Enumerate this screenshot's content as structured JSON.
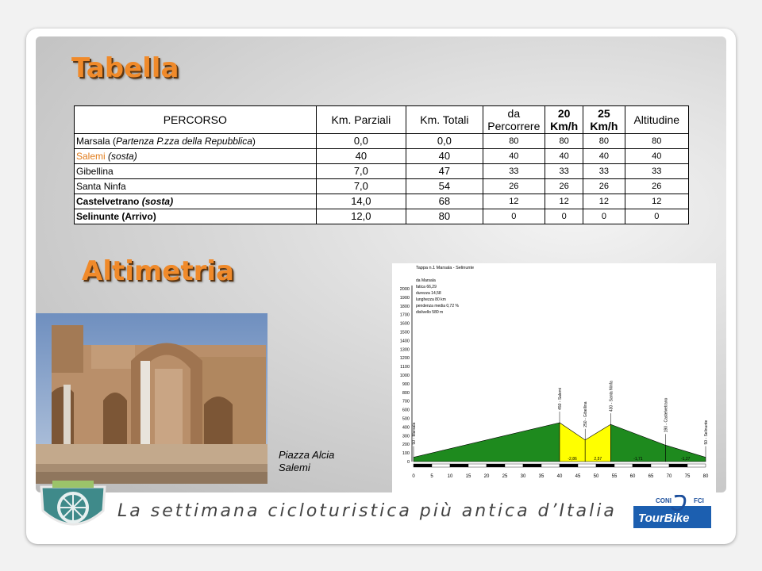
{
  "slide": {
    "title_table": "Tabella",
    "title_altimetry": "Altimetria",
    "tagline": "La settimana cicloturistica più antica d’Italia"
  },
  "table": {
    "headers": {
      "percorso": "PERCORSO",
      "km_parziali": "Km. Parziali",
      "km_totali": "Km. Totali",
      "da": "da",
      "percorrere": "Percorrere",
      "v20a": "20",
      "v20b": "Km/h",
      "v25a": "25",
      "v25b": "Km/h",
      "altitudine": "Altitudine"
    },
    "rows": [
      {
        "name_a": "Marsala",
        "name_b": " (",
        "name_c": "Partenza  P.zza della Repubblica",
        "name_d": ")",
        "parz": "0,0",
        "tot": "0,0",
        "da": "80",
        "v20": "80",
        "v25": "80",
        "alt": "80"
      },
      {
        "name_a": "Salemi",
        "name_b": " ",
        "name_c": "(sosta)",
        "name_d": "",
        "parz": "40",
        "tot": "40",
        "da": "40",
        "v20": "40",
        "v25": "40",
        "alt": "40"
      },
      {
        "name_a": "Gibellina",
        "name_b": "",
        "name_c": "",
        "name_d": "",
        "parz": "7,0",
        "tot": "47",
        "da": "33",
        "v20": "33",
        "v25": "33",
        "alt": "33"
      },
      {
        "name_a": "Santa Ninfa",
        "name_b": "",
        "name_c": "",
        "name_d": "",
        "parz": "7,0",
        "tot": "54",
        "da": "26",
        "v20": "26",
        "v25": "26",
        "alt": "26"
      },
      {
        "name_a": "Castelvetrano",
        "name_b": "  ",
        "name_c": "(sosta)",
        "name_d": "",
        "parz": "14,0",
        "tot": "68",
        "da": "12",
        "v20": "12",
        "v25": "12",
        "alt": "12"
      },
      {
        "name_a": "Selinunte",
        "name_b": "  (Arrivo)",
        "name_c": "",
        "name_d": "",
        "parz": "12,0",
        "tot": "80",
        "da": "0",
        "v20": "0",
        "v25": "0",
        "alt": "0"
      }
    ]
  },
  "photo": {
    "caption_line1": "Piazza Alcia",
    "caption_line2": "Salemi"
  },
  "altimetry": {
    "stage_title": "Tappa n.1 Marsala - Selinunte",
    "info": [
      "da Marsala",
      "fatica 66,29",
      "durezza 14,58",
      "lunghezza 80 km",
      "pendenza media 0,72 %",
      "dislivello 580 m"
    ],
    "y_ticks": [
      "2000",
      "1900",
      "1800",
      "1700",
      "1600",
      "1500",
      "1400",
      "1300",
      "1200",
      "1100",
      "1000",
      "900",
      "800",
      "700",
      "600",
      "500",
      "400",
      "300",
      "200",
      "100",
      "0"
    ],
    "x_ticks": [
      "0",
      "5",
      "10",
      "15",
      "20",
      "25",
      "30",
      "35",
      "40",
      "45",
      "50",
      "55",
      "60",
      "65",
      "70",
      "75",
      "80"
    ],
    "points": [
      {
        "km": 0,
        "alt": 50,
        "label": "50 - Marsala"
      },
      {
        "km": 40,
        "alt": 450,
        "label": "450 - Salemi"
      },
      {
        "km": 47,
        "alt": 250,
        "label": "250 - Gibellina"
      },
      {
        "km": 54,
        "alt": 430,
        "label": "430 - Santa Ninfa"
      },
      {
        "km": 69,
        "alt": 190,
        "label": "190 - Castelvetrano"
      },
      {
        "km": 80,
        "alt": 50,
        "label": "50 - Selinunte"
      }
    ],
    "gradients": [
      "",
      "-2,86",
      "2,57",
      "-1,71",
      "-1,27"
    ],
    "colors": {
      "green": "#1e8a1e",
      "yellow": "#ffff00"
    }
  },
  "logos": {
    "right_top_left": "CONI",
    "right_top_right": "FCI",
    "right_main": "TourBike"
  }
}
